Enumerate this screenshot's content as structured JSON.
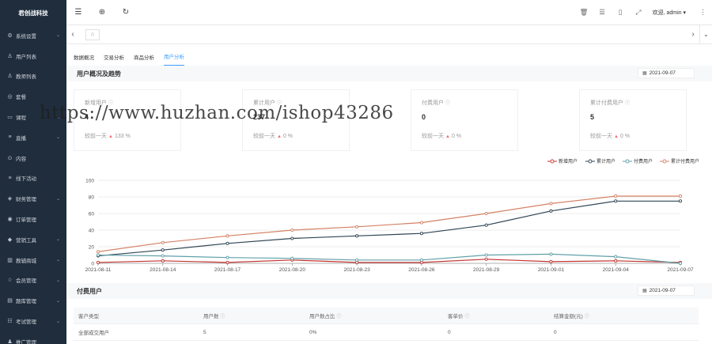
{
  "brand": "君创战科技",
  "sidebar": {
    "items": [
      {
        "icon": "⚙",
        "label": "系统设置",
        "chevron": true
      },
      {
        "icon": "♙",
        "label": "用户列表",
        "chevron": false
      },
      {
        "icon": "♙",
        "label": "教师列表",
        "chevron": false
      },
      {
        "icon": "◎",
        "label": "套餐",
        "chevron": false
      },
      {
        "icon": "▭",
        "label": "课程",
        "chevron": true
      },
      {
        "icon": "≡",
        "label": "直播",
        "chevron": true
      },
      {
        "icon": "⊙",
        "label": "内容",
        "chevron": false
      },
      {
        "icon": "≡",
        "label": "线下活动",
        "chevron": false
      },
      {
        "icon": "◈",
        "label": "财务管理",
        "chevron": true
      },
      {
        "icon": "◉",
        "label": "订单管理",
        "chevron": false
      },
      {
        "icon": "◆",
        "label": "营销工具",
        "chevron": true
      },
      {
        "icon": "▥",
        "label": "教辅商城",
        "chevron": true
      },
      {
        "icon": "☆",
        "label": "会员管理",
        "chevron": true
      },
      {
        "icon": "▤",
        "label": "题库管理",
        "chevron": true
      },
      {
        "icon": "☷",
        "label": "考试管理",
        "chevron": true
      },
      {
        "icon": "♟",
        "label": "推广管理",
        "chevron": false
      }
    ]
  },
  "header": {
    "welcome": "欢迎, admin ▾"
  },
  "subtabs": [
    "数据概况",
    "交易分析",
    "商品分析",
    "用户分析"
  ],
  "overview": {
    "title": "用户概况及趋势",
    "date": "2021-09-07",
    "cards": [
      {
        "title": "新增用户",
        "value": "4",
        "compare": "较前一天",
        "pct": "133 %"
      },
      {
        "title": "累计用户",
        "value": "237",
        "compare": "较前一天",
        "pct": "0 %"
      },
      {
        "title": "付费用户",
        "value": "0",
        "compare": "较前一天",
        "pct": "0 %"
      },
      {
        "title": "累计付费用户",
        "value": "5",
        "compare": "较前一天",
        "pct": "0 %"
      }
    ]
  },
  "chart_data": {
    "type": "line",
    "x": [
      "2021-08-11",
      "2021-08-14",
      "2021-08-17",
      "2021-08-20",
      "2021-08-23",
      "2021-08-26",
      "2021-08-29",
      "2021-09-01",
      "2021-09-04",
      "2021-09-07"
    ],
    "ylim": [
      0,
      100
    ],
    "yticks": [
      0,
      20,
      40,
      60,
      80,
      100
    ],
    "legend": "top-right",
    "grid": true,
    "series": [
      {
        "name": "新增用户",
        "color": "#c23531",
        "values": [
          1,
          3,
          1,
          4,
          1,
          1,
          5,
          2,
          3,
          1
        ]
      },
      {
        "name": "累计用户",
        "color": "#2f4554",
        "values": [
          9,
          16,
          24,
          30,
          33,
          36,
          46,
          63,
          75,
          75
        ]
      },
      {
        "name": "付费用户",
        "color": "#61a0a8",
        "values": [
          10,
          9,
          7,
          6,
          4,
          4,
          10,
          11,
          8,
          0
        ]
      },
      {
        "name": "累计付费用户",
        "color": "#d48265",
        "values": [
          14,
          25,
          33,
          40,
          44,
          49,
          60,
          72,
          81,
          81
        ]
      }
    ]
  },
  "paid": {
    "title": "付费用户",
    "date": "2021-09-07",
    "columns": [
      "客户类型",
      "用户数",
      "用户数占比",
      "客单价",
      "结算金额(元)"
    ],
    "rows": [
      [
        "全部成交用户",
        "5",
        "0%",
        "0",
        "0"
      ]
    ]
  },
  "watermark": "https://www.huzhan.com/ishop43286"
}
